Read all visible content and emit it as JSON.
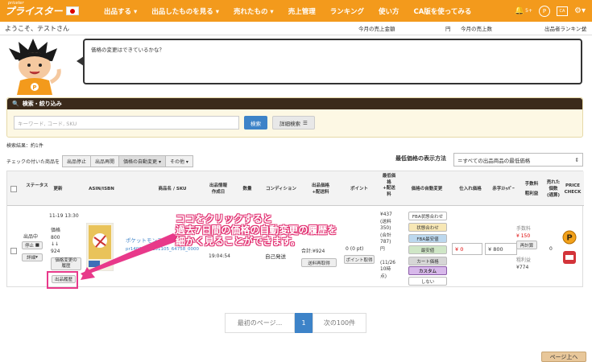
{
  "nav": {
    "logo_small": "priceter",
    "logo": "プライスター",
    "items": [
      "出品する ▾",
      "出品したものを見る ▾",
      "売れたもの ▾",
      "売上管理",
      "ランキング",
      "使い方",
      "CA版を使ってみる"
    ],
    "badge": "5+",
    "icon2": "CA"
  },
  "info": {
    "welcome": "ようこそ、テストさん",
    "today_sales": "今月の売上金額",
    "yen": "円",
    "today_count": "今月の売上数",
    "rank": "出品者ランキング",
    "rank_unit": "位"
  },
  "speech": "価格の変更はできているかな？",
  "search": {
    "header": "検索・絞り込み",
    "placeholder": "キーワード, コード, SKU",
    "button": "検索",
    "detail": "詳細検索"
  },
  "results": "検索結果：約1件",
  "actions": {
    "label": "チェックの付いた商品を",
    "stop": "出品停止",
    "resume": "出品再開",
    "auto": "価格の自動変更 ▾",
    "other": "その他 ▾"
  },
  "lowest": {
    "label": "最低価格の表示方法",
    "value": "＝すべての出品商品の最低価格"
  },
  "headers": {
    "status": "ステータス",
    "updated": "更新",
    "asin": "ASIN/ISBN",
    "name": "商品名 / SKU",
    "created": "出品情報\n作成日",
    "qty": "数量",
    "cond": "コンディション",
    "price": "出品価格\n+配送料",
    "point": "ポイント",
    "lowest": "最低価\n格\n+配送\n料",
    "autochg": "価格の自動変更",
    "cost": "仕入れ価格",
    "stopper": "赤字ｽﾄｯﾊﾟｰ",
    "fee": "手数料\n粗利益",
    "sold": "売れた\n個数\n(通算)",
    "pricecheck": "PRICE\nCHECK"
  },
  "row": {
    "status": "出品中",
    "stop_btn": "停止",
    "detail_btn": "詳細",
    "time": "11-19 13:30",
    "price_label": "価格",
    "old_price": "800",
    "arrow": "↓↓",
    "new_price": "924",
    "history_btn": "価格変更の\n履歴",
    "history_btn2": "出品履歴",
    "product_name": "ポケットモンスター ホワイト",
    "sku": "pr14021_20151105_64758_0000",
    "created_time": "19:04:54",
    "cond": "自己発送",
    "total": "合計:¥924",
    "shipping_btn": "送料再取得",
    "points": "0 (0 pt)",
    "point_btn": "ポイント取得",
    "lowest_price": "¥437\n(送料\n350)\n(合計\n787)\n円\n\n(11/26\n10時\n点)",
    "tags": [
      "FBA状態合わせ",
      "状態合わせ",
      "FBA最安値",
      "最安値",
      "カート価格",
      "カスタム",
      "しない"
    ],
    "cost": "¥ 0",
    "stopper": "¥ 800",
    "fee_label": "手数料",
    "fee": "¥ 150",
    "recalc": "再計算",
    "profit_label": "粗利益",
    "profit": "¥774",
    "sold": "0"
  },
  "annotation": {
    "line1": "ココをクリックすると",
    "line2": "過去7日間の価格の自動変更の履歴を",
    "line3": "細かく見ることができます。"
  },
  "pager": {
    "first": "最初のページ...",
    "current": "1",
    "next": "次の100件"
  },
  "top_btn": "ページ上へ"
}
